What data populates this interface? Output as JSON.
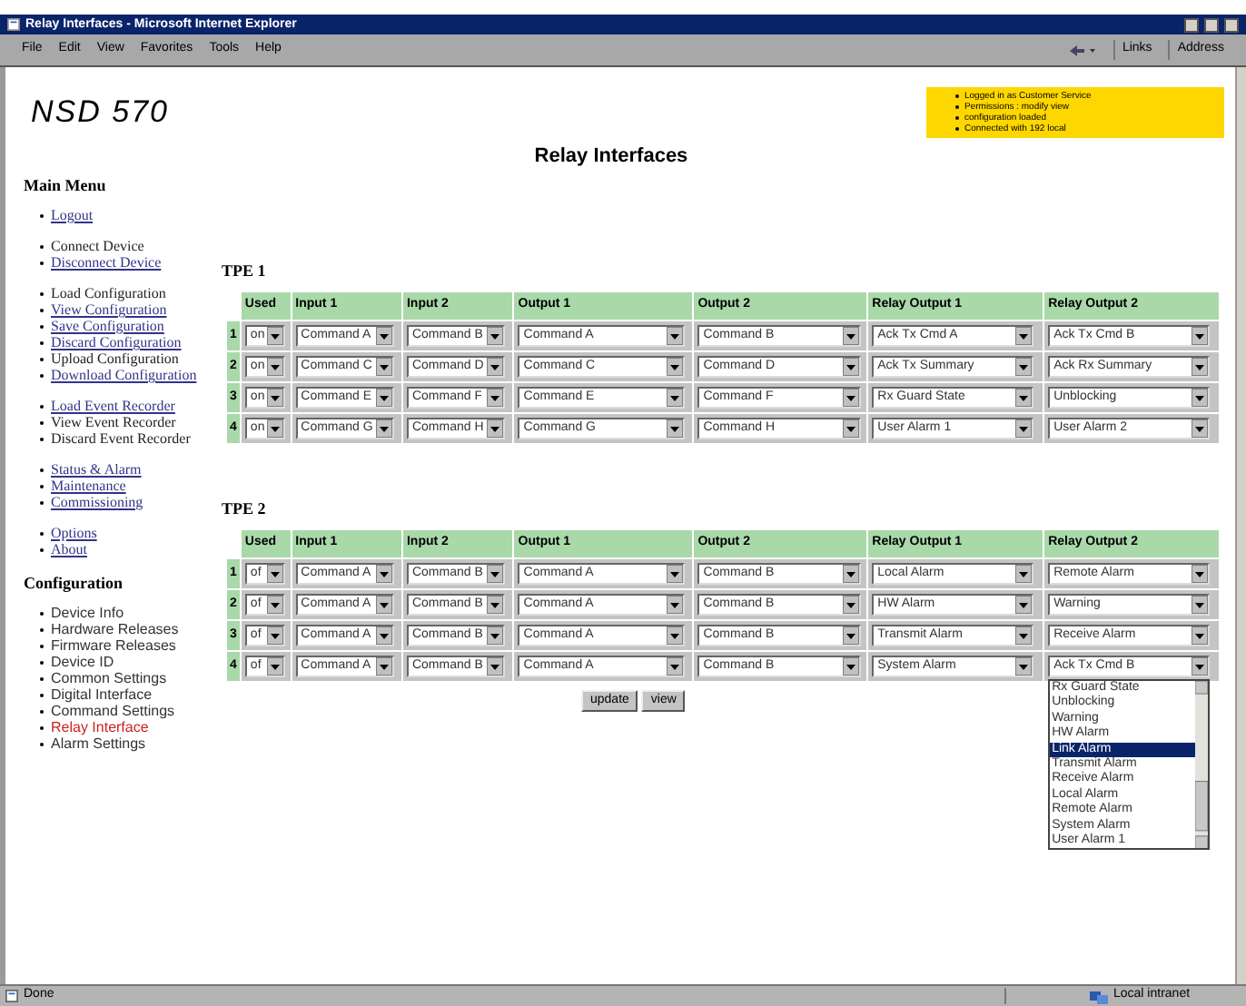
{
  "window": {
    "title": "Relay Interfaces - Microsoft Internet Explorer"
  },
  "menu_bar": [
    "File",
    "Edit",
    "View",
    "Favorites",
    "Tools",
    "Help"
  ],
  "toolbar": {
    "links": "Links",
    "address": "Address"
  },
  "logo": "NSD 570",
  "status_box": [
    "Logged in as Customer Service",
    "Permissions : modify view",
    "configuration loaded",
    "Connected with 192 local"
  ],
  "page_title": "Relay Interfaces",
  "sidebar": [
    {
      "heading": "Main Menu",
      "groups": [
        [
          {
            "label": "Logout",
            "kind": "link"
          }
        ],
        [
          {
            "label": "Connect Device",
            "kind": "text"
          },
          {
            "label": "Disconnect Device",
            "kind": "link"
          }
        ],
        [
          {
            "label": "Load Configuration",
            "kind": "text"
          },
          {
            "label": "View Configuration",
            "kind": "link"
          },
          {
            "label": "Save Configuration",
            "kind": "link"
          },
          {
            "label": "Discard Configuration",
            "kind": "link"
          },
          {
            "label": "Upload Configuration",
            "kind": "text"
          },
          {
            "label": "Download Configuration",
            "kind": "link"
          }
        ],
        [
          {
            "label": "Load Event Recorder",
            "kind": "link"
          },
          {
            "label": "View Event Recorder",
            "kind": "text"
          },
          {
            "label": "Discard Event Recorder",
            "kind": "text"
          }
        ],
        [
          {
            "label": "Status & Alarm",
            "kind": "link"
          },
          {
            "label": "Maintenance",
            "kind": "link"
          },
          {
            "label": "Commissioning",
            "kind": "link"
          }
        ],
        [
          {
            "label": "Options",
            "kind": "link"
          },
          {
            "label": "About",
            "kind": "link"
          }
        ]
      ]
    },
    {
      "heading": "Configuration",
      "groups": [
        [
          {
            "label": "Device Info",
            "kind": "item",
            "selected": false
          },
          {
            "label": "Hardware Releases",
            "kind": "item",
            "selected": false
          },
          {
            "label": "Firmware Releases",
            "kind": "item",
            "selected": false
          },
          {
            "label": "Device ID",
            "kind": "item",
            "selected": false
          },
          {
            "label": "Common Settings",
            "kind": "item",
            "selected": false
          },
          {
            "label": "Digital Interface",
            "kind": "item",
            "selected": false
          },
          {
            "label": "Command Settings",
            "kind": "item",
            "selected": false
          },
          {
            "label": "Relay Interface",
            "kind": "item",
            "selected": true
          },
          {
            "label": "Alarm Settings",
            "kind": "item",
            "selected": false
          }
        ]
      ]
    }
  ],
  "tables": [
    {
      "title": "TPE 1",
      "columns": [
        "Used",
        "Input 1",
        "Input 2",
        "Output 1",
        "Output 2",
        "Relay Output 1",
        "Relay Output 2"
      ],
      "rows": [
        {
          "number": "1",
          "cells": [
            {
              "value": "on"
            },
            {
              "value": "Command A"
            },
            {
              "value": "Command B"
            },
            {
              "value": "Command A"
            },
            {
              "value": "Command B"
            },
            {
              "value": "Ack Tx Cmd A"
            },
            {
              "value": "Ack Tx Cmd B"
            }
          ]
        },
        {
          "number": "2",
          "cells": [
            {
              "value": "on"
            },
            {
              "value": "Command C"
            },
            {
              "value": "Command D"
            },
            {
              "value": "Command C"
            },
            {
              "value": "Command D"
            },
            {
              "value": "Ack Tx Summary"
            },
            {
              "value": "Ack Rx Summary"
            }
          ]
        },
        {
          "number": "3",
          "cells": [
            {
              "value": "on"
            },
            {
              "value": "Command E"
            },
            {
              "value": "Command F"
            },
            {
              "value": "Command E"
            },
            {
              "value": "Command F"
            },
            {
              "value": "Rx Guard State"
            },
            {
              "value": "Unblocking"
            }
          ]
        },
        {
          "number": "4",
          "cells": [
            {
              "value": "on"
            },
            {
              "value": "Command G"
            },
            {
              "value": "Command H"
            },
            {
              "value": "Command G"
            },
            {
              "value": "Command H"
            },
            {
              "value": "User Alarm 1"
            },
            {
              "value": "User Alarm 2"
            }
          ]
        }
      ]
    },
    {
      "title": "TPE 2",
      "columns": [
        "Used",
        "Input 1",
        "Input 2",
        "Output 1",
        "Output 2",
        "Relay Output 1",
        "Relay Output 2"
      ],
      "rows": [
        {
          "number": "1",
          "cells": [
            {
              "value": "of"
            },
            {
              "value": "Command A"
            },
            {
              "value": "Command B"
            },
            {
              "value": "Command A"
            },
            {
              "value": "Command B"
            },
            {
              "value": "Local Alarm"
            },
            {
              "value": "Remote Alarm"
            }
          ]
        },
        {
          "number": "2",
          "cells": [
            {
              "value": "of"
            },
            {
              "value": "Command A"
            },
            {
              "value": "Command B"
            },
            {
              "value": "Command A"
            },
            {
              "value": "Command B"
            },
            {
              "value": "HW Alarm"
            },
            {
              "value": "Warning"
            }
          ]
        },
        {
          "number": "3",
          "cells": [
            {
              "value": "of"
            },
            {
              "value": "Command A"
            },
            {
              "value": "Command B"
            },
            {
              "value": "Command A"
            },
            {
              "value": "Command B"
            },
            {
              "value": "Transmit Alarm"
            },
            {
              "value": "Receive Alarm"
            }
          ]
        },
        {
          "number": "4",
          "cells": [
            {
              "value": "of"
            },
            {
              "value": "Command A"
            },
            {
              "value": "Command B"
            },
            {
              "value": "Command A"
            },
            {
              "value": "Command B"
            },
            {
              "value": "System Alarm"
            },
            {
              "value": "Ack Tx Cmd B",
              "options": [
                {
                  "label": "Rx Guard State",
                  "selected": false
                },
                {
                  "label": "Unblocking",
                  "selected": false
                },
                {
                  "label": "Warning",
                  "selected": false
                },
                {
                  "label": "HW Alarm",
                  "selected": false
                },
                {
                  "label": "Link Alarm",
                  "selected": true
                },
                {
                  "label": "Transmit Alarm",
                  "selected": false
                },
                {
                  "label": "Receive Alarm",
                  "selected": false
                },
                {
                  "label": "Local Alarm",
                  "selected": false
                },
                {
                  "label": "Remote Alarm",
                  "selected": false
                },
                {
                  "label": "System Alarm",
                  "selected": false
                },
                {
                  "label": "User Alarm 1",
                  "selected": false
                }
              ]
            }
          ]
        }
      ]
    }
  ],
  "buttons": [
    "update",
    "view"
  ],
  "status_bar": {
    "text": "Done",
    "zone": "Local intranet"
  }
}
